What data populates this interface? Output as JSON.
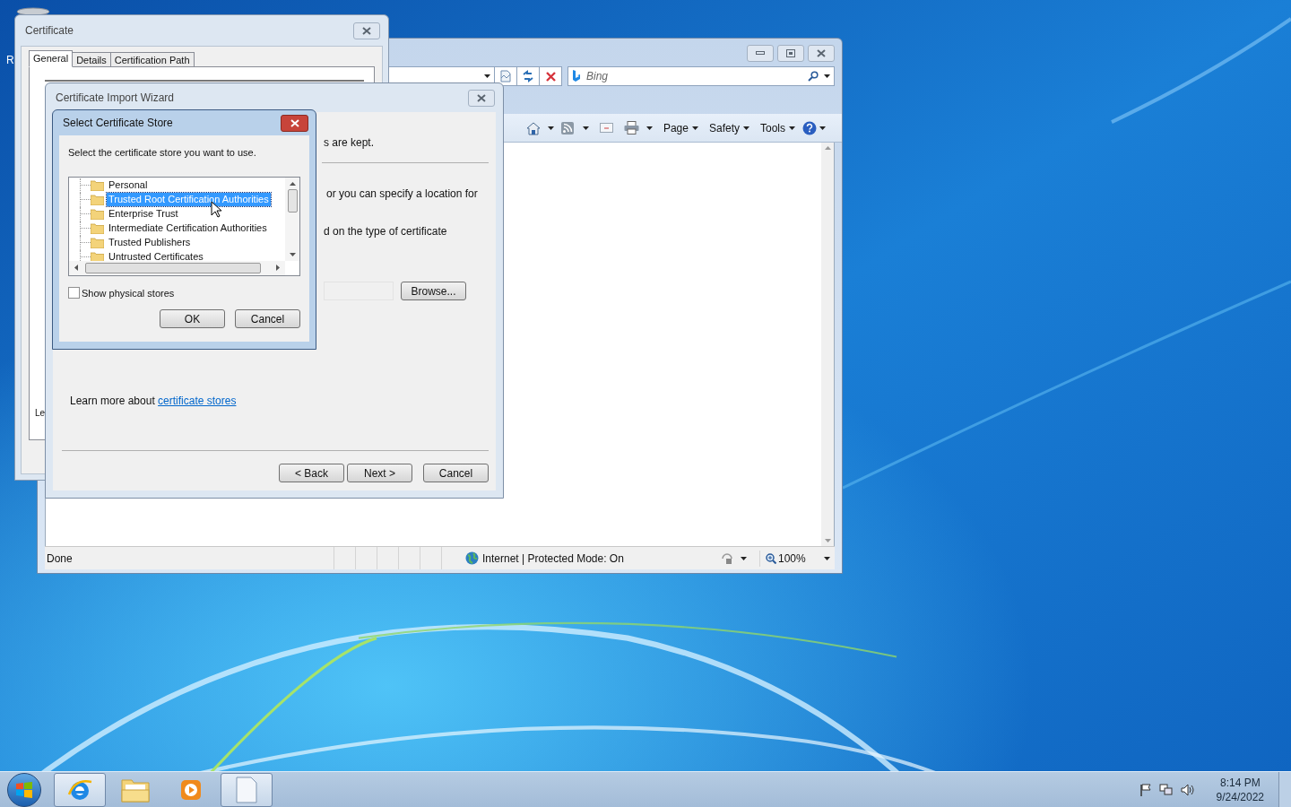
{
  "desktop": {
    "icon_label": "R"
  },
  "browser": {
    "search_placeholder": "Bing",
    "command_menus": [
      {
        "label": "Page"
      },
      {
        "label": "Safety"
      },
      {
        "label": "Tools"
      }
    ],
    "status": "Done",
    "zone": "Internet | Protected Mode: On",
    "zoom": "100%"
  },
  "certificate_window": {
    "title": "Certificate",
    "tabs": [
      {
        "label": "General",
        "selected": true
      },
      {
        "label": "Details",
        "selected": false
      },
      {
        "label": "Certification Path",
        "selected": false
      }
    ],
    "body_text": "Le"
  },
  "wizard": {
    "title": "Certificate Import Wizard",
    "lines": [
      "s are kept.",
      "or you can specify a location for",
      "d on the type of certificate"
    ],
    "browse_button": "Browse...",
    "learn_more": {
      "text": "Learn more about",
      "link": "certificate stores"
    },
    "buttons": [
      "< Back",
      "Next >",
      "Cancel"
    ]
  },
  "store_dialog": {
    "title": "Select Certificate Store",
    "prompt": "Select the certificate store you want to use.",
    "stores": [
      {
        "name": "Personal",
        "selected": false
      },
      {
        "name": "Trusted Root Certification Authorities",
        "selected": true
      },
      {
        "name": "Enterprise Trust",
        "selected": false
      },
      {
        "name": "Intermediate Certification Authorities",
        "selected": false
      },
      {
        "name": "Trusted Publishers",
        "selected": false
      },
      {
        "name": "Untrusted Certificates",
        "selected": false
      }
    ],
    "show_physical_stores": {
      "label": "Show physical stores",
      "checked": false
    },
    "buttons": [
      "OK",
      "Cancel"
    ]
  },
  "taskbar": {
    "apps": [
      {
        "kind": "browser",
        "running": true
      },
      {
        "kind": "folder",
        "running": false
      },
      {
        "kind": "media",
        "running": false
      },
      {
        "kind": "document",
        "running": true
      }
    ],
    "time": "8:14 PM",
    "date": "9/24/2022"
  }
}
